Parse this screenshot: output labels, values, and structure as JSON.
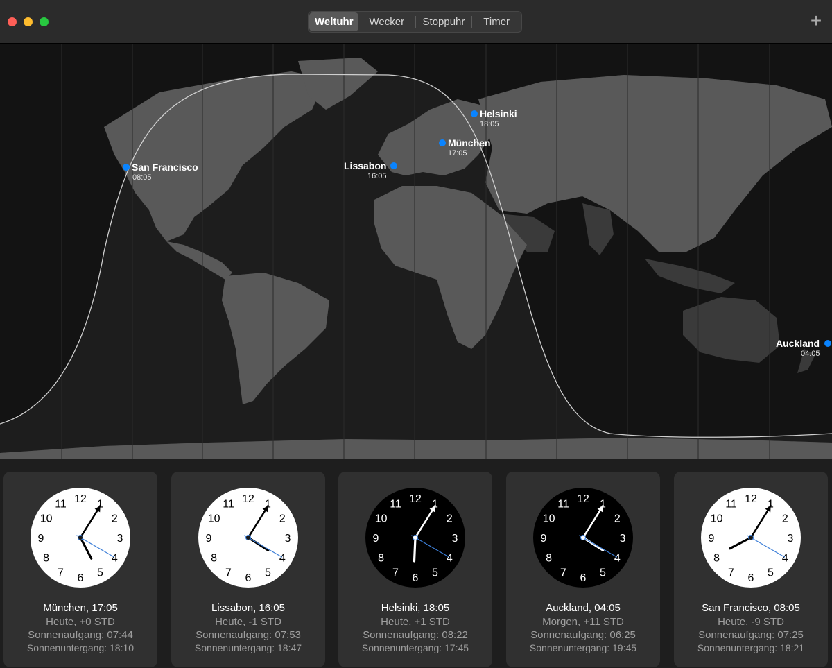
{
  "toolbar": {
    "tabs": [
      {
        "label": "Weltuhr",
        "active": true
      },
      {
        "label": "Wecker",
        "active": false
      },
      {
        "label": "Stoppuhr",
        "active": false
      },
      {
        "label": "Timer",
        "active": false
      }
    ],
    "add_label": "+"
  },
  "map": {
    "cities": [
      {
        "name": "San Francisco",
        "time": "08:05"
      },
      {
        "name": "Lissabon",
        "time": "16:05"
      },
      {
        "name": "München",
        "time": "17:05"
      },
      {
        "name": "Helsinki",
        "time": "18:05"
      },
      {
        "name": "Auckland",
        "time": "04:05"
      }
    ],
    "dot_color": "#0a84ff"
  },
  "clocks": [
    {
      "title": "München, 17:05",
      "day": "Heute, +0 STD",
      "sunrise": "Sonnenaufgang: 07:44",
      "sunset": "Sonnenuntergang: 18:10",
      "theme": "light",
      "hour": 17,
      "minute": 5,
      "second": 20
    },
    {
      "title": "Lissabon, 16:05",
      "day": "Heute, -1 STD",
      "sunrise": "Sonnenaufgang: 07:53",
      "sunset": "Sonnenuntergang: 18:47",
      "theme": "light",
      "hour": 16,
      "minute": 5,
      "second": 20
    },
    {
      "title": "Helsinki, 18:05",
      "day": "Heute, +1 STD",
      "sunrise": "Sonnenaufgang: 08:22",
      "sunset": "Sonnenuntergang: 17:45",
      "theme": "dark",
      "hour": 18,
      "minute": 5,
      "second": 20
    },
    {
      "title": "Auckland, 04:05",
      "day": "Morgen, +11 STD",
      "sunrise": "Sonnenaufgang: 06:25",
      "sunset": "Sonnenuntergang: 19:45",
      "theme": "dark",
      "hour": 4,
      "minute": 5,
      "second": 20
    },
    {
      "title": "San Francisco, 08:05",
      "day": "Heute, -9 STD",
      "sunrise": "Sonnenaufgang: 07:25",
      "sunset": "Sonnenuntergang: 18:21",
      "theme": "light",
      "hour": 8,
      "minute": 5,
      "second": 20
    }
  ],
  "clock_numbers": [
    "12",
    "1",
    "2",
    "3",
    "4",
    "5",
    "6",
    "7",
    "8",
    "9",
    "10",
    "11"
  ]
}
